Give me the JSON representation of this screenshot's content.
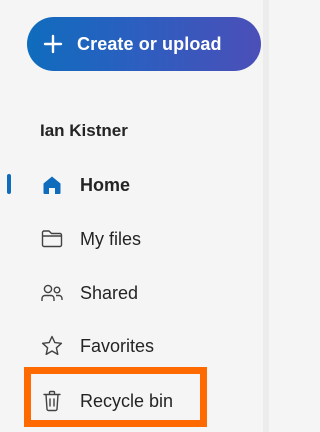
{
  "create_button": {
    "label": "Create or upload",
    "icon": "plus-icon"
  },
  "user": {
    "name": "Ian Kistner"
  },
  "nav": {
    "items": [
      {
        "label": "Home",
        "icon": "home-icon",
        "active": true
      },
      {
        "label": "My files",
        "icon": "folder-icon",
        "active": false
      },
      {
        "label": "Shared",
        "icon": "people-icon",
        "active": false
      },
      {
        "label": "Favorites",
        "icon": "star-icon",
        "active": false
      },
      {
        "label": "Recycle bin",
        "icon": "trash-icon",
        "active": false
      }
    ]
  },
  "colors": {
    "accent": "#0f6cbd",
    "button_gradient_end": "#4b4fb8",
    "highlight": "#ff6a00",
    "background": "#f5f5f5"
  }
}
